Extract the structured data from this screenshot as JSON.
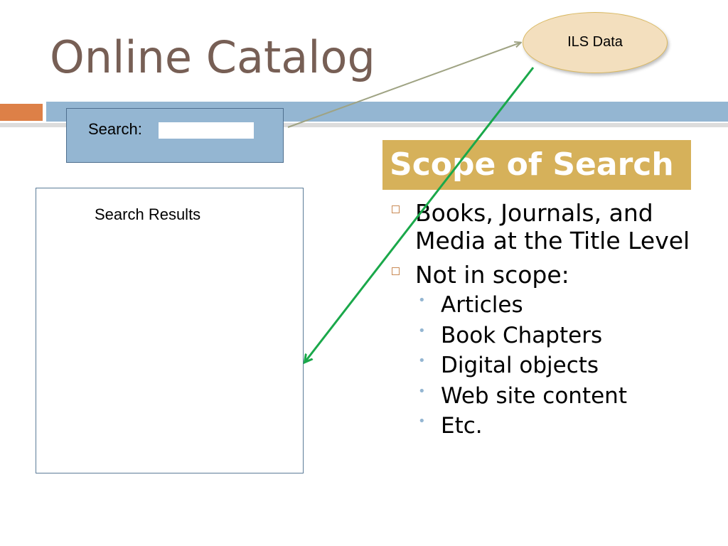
{
  "slide": {
    "title": "Online Catalog"
  },
  "search_panel": {
    "label": "Search:",
    "input_value": ""
  },
  "results_panel": {
    "label": "Search Results"
  },
  "data_source": {
    "label": "ILS Data"
  },
  "scope": {
    "heading": "Scope of Search",
    "items": [
      {
        "text": "Books, Journals, and Media at the Title Level"
      },
      {
        "text": "Not in scope:"
      }
    ],
    "out_of_scope": [
      "Articles",
      "Book Chapters",
      "Digital objects",
      "Web site content",
      "Etc."
    ]
  },
  "colors": {
    "title_text": "#775f55",
    "band_blue": "#94b6d2",
    "band_orange": "#dd8047",
    "scope_header_gold": "#d6b15a",
    "ellipse_fill": "#f3dfbe",
    "query_arrow": "#9fa383",
    "results_arrow": "#1aa84a"
  }
}
